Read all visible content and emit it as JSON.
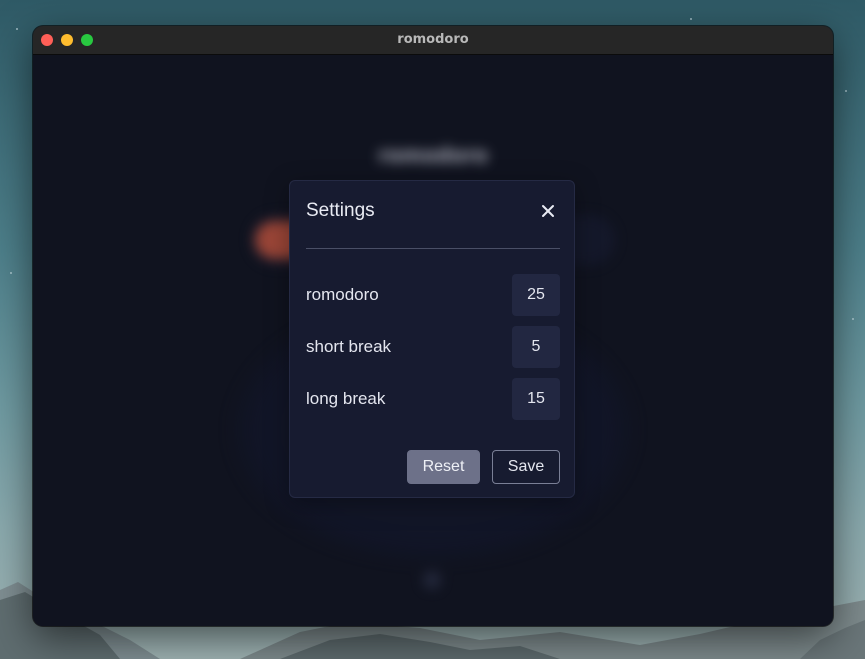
{
  "window": {
    "title": "romodoro"
  },
  "background": {
    "heading": "romodoro"
  },
  "settings": {
    "title": "Settings",
    "close_icon": "close-icon",
    "rows": [
      {
        "label": "romodoro",
        "value": "25"
      },
      {
        "label": "short break",
        "value": "5"
      },
      {
        "label": "long break",
        "value": "15"
      }
    ],
    "reset_label": "Reset",
    "save_label": "Save"
  },
  "colors": {
    "window_bg": "#10131f",
    "modal_bg": "#171b30",
    "input_bg": "#222741",
    "reset_bg": "#6d7189",
    "accent_tab": "#c8563f"
  }
}
